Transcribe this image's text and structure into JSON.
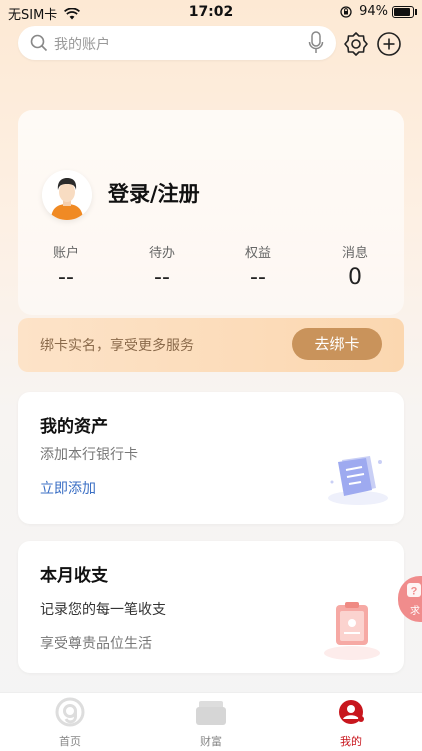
{
  "status_bar": {
    "carrier": "无SIM卡",
    "time": "17:02",
    "battery": "94%"
  },
  "search": {
    "placeholder": "我的账户"
  },
  "profile": {
    "login_label": "登录/注册",
    "stats": [
      {
        "label": "账户",
        "value": "--"
      },
      {
        "label": "待办",
        "value": "--"
      },
      {
        "label": "权益",
        "value": "--"
      },
      {
        "label": "消息",
        "value": "0"
      }
    ]
  },
  "bind_banner": {
    "text": "绑卡实名，享受更多服务",
    "button": "去绑卡"
  },
  "assets_card": {
    "title": "我的资产",
    "subtitle": "添加本行银行卡",
    "link": "立即添加"
  },
  "income_card": {
    "title": "本月收支",
    "line1": "记录您的每一笔收支",
    "line2": "享受尊贵品位生活"
  },
  "float_badge": {
    "text": "求"
  },
  "tabbar": {
    "tabs": [
      {
        "label": "首页",
        "icon": "home-icon"
      },
      {
        "label": "财富",
        "icon": "wealth-icon"
      },
      {
        "label": "我的",
        "icon": "profile-icon"
      }
    ],
    "active_index": 2
  },
  "colors": {
    "accent": "#c8161d",
    "bind_button": "#c9935b",
    "link": "#3b6fc4"
  }
}
